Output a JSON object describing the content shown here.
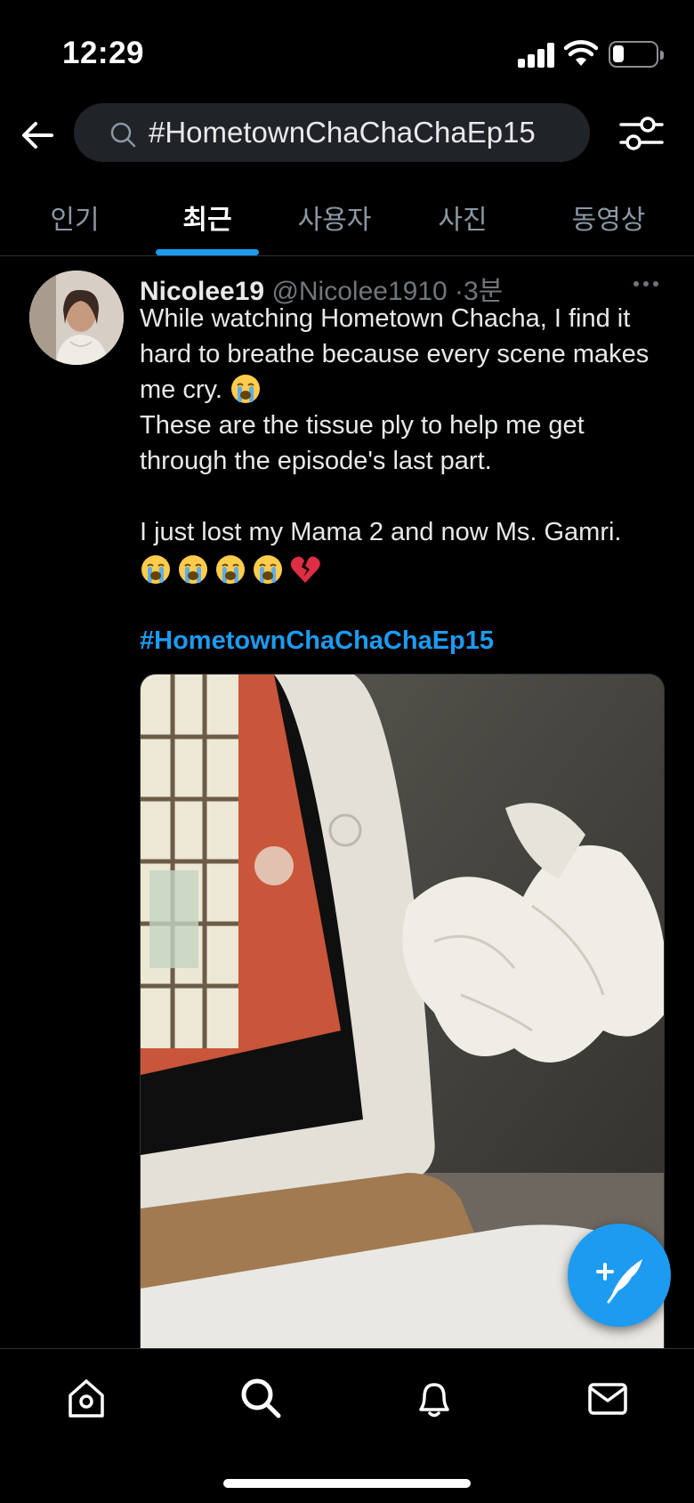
{
  "status_bar": {
    "time": "12:29"
  },
  "search": {
    "query": "#HometownChaChaChaEp15"
  },
  "tabs": [
    {
      "label": "인기",
      "active": false
    },
    {
      "label": "최근",
      "active": true
    },
    {
      "label": "사용자",
      "active": false
    },
    {
      "label": "사진",
      "active": false
    },
    {
      "label": "동영상",
      "active": false
    }
  ],
  "tweet": {
    "display_name": "Nicolee19",
    "handle": "@Nicolee1910",
    "separator": "·",
    "time": "3분",
    "lines": [
      "While watching Hometown Chacha, I find it hard to breathe because every scene makes me cry.",
      "These are the tissue ply to help me get through the episode's last part.",
      "I just lost my Mama 2 and now Ms. Gamri."
    ],
    "emojis": [
      "loudly-crying-face",
      "loudly-crying-face",
      "loudly-crying-face",
      "loudly-crying-face",
      "broken-heart"
    ],
    "hashtag": "#HometownChaChaChaEp15"
  },
  "colors": {
    "accent": "#1d9bf0",
    "background": "#000000",
    "secondary_text": "#71767b"
  },
  "bottom_nav": [
    "home-icon",
    "search-icon",
    "bell-icon",
    "mail-icon"
  ]
}
